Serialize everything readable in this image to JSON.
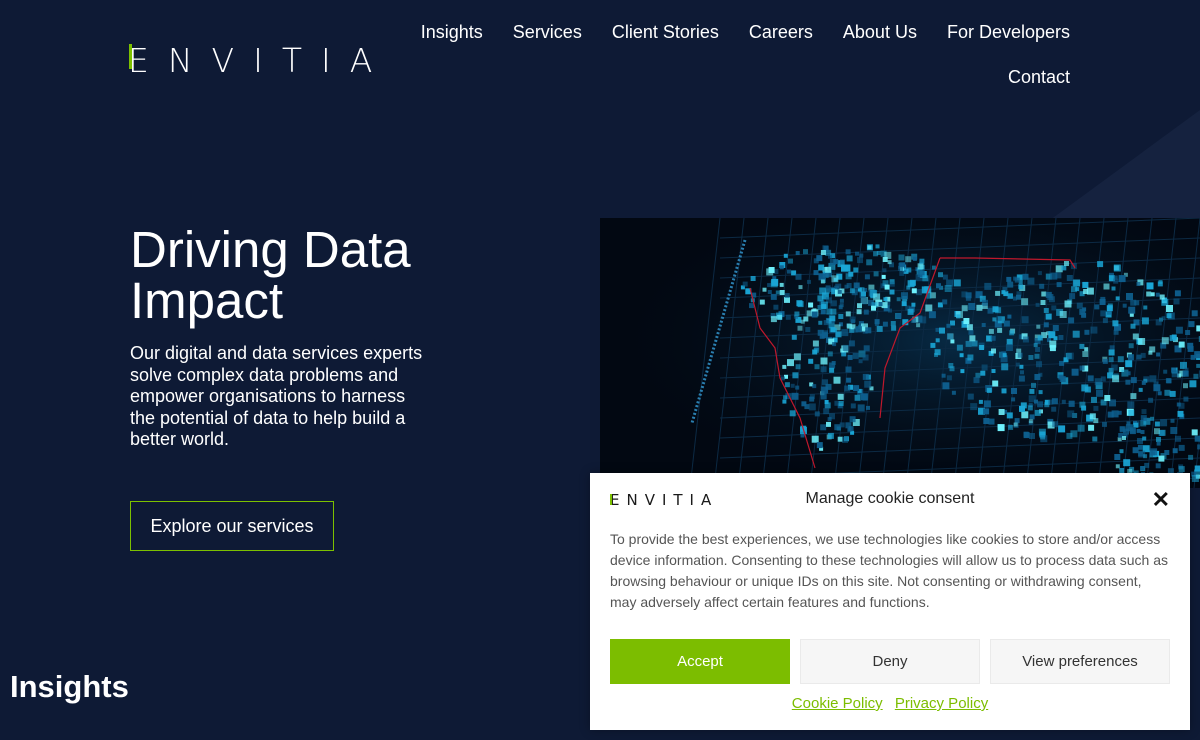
{
  "brand": {
    "name_first": "E",
    "name_rest": "NVITIA",
    "accent": "#7cc000",
    "background": "#0e1a35"
  },
  "nav": {
    "items": [
      "Insights",
      "Services",
      "Client Stories",
      "Careers",
      "About Us",
      "For Developers"
    ],
    "contact": "Contact"
  },
  "hero": {
    "title": "Driving Data Impact",
    "text": "Our digital and data services experts solve complex data problems and empower organisations to harness the potential of data to help build a better world.",
    "cta": "Explore our services",
    "image_icon": "world-map-data-grid-image"
  },
  "section": {
    "title": "Insights"
  },
  "cookie": {
    "logo_first": "E",
    "logo_rest": "NVITIA",
    "title": "Manage cookie consent",
    "close": "✕",
    "text": "To provide the best experiences, we use technologies like cookies to store and/or access device information. Consenting to these technologies will allow us to process data such as browsing behaviour or unique IDs on this site. Not consenting or withdrawing consent, may adversely affect certain features and functions.",
    "accept": "Accept",
    "deny": "Deny",
    "preferences": "View preferences",
    "cookie_policy": "Cookie Policy",
    "privacy_policy": "Privacy Policy",
    "accept_color": "#7cbd00"
  }
}
